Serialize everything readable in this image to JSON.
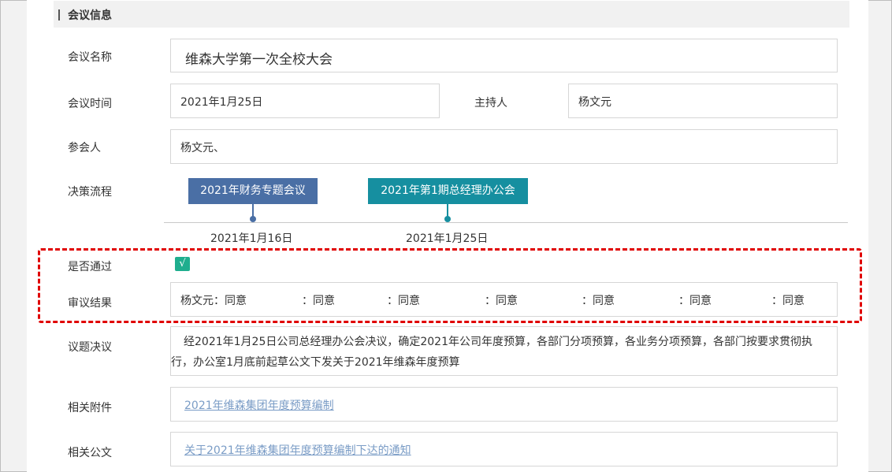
{
  "section": {
    "title": "会议信息"
  },
  "meeting_name": {
    "label": "会议名称",
    "value": "维森大学第一次全校大会"
  },
  "meeting_time": {
    "label": "会议时间",
    "value": "2021年1月25日"
  },
  "host": {
    "label": "主持人",
    "value": "杨文元"
  },
  "attendees": {
    "label": "参会人",
    "value": "杨文元、"
  },
  "process": {
    "label": "决策流程",
    "nodes": [
      {
        "title": "2021年财务专题会议",
        "date": "2021年1月16日",
        "color": "#4a6fa5"
      },
      {
        "title": "2021年第1期总经理办公会",
        "date": "2021年1月25日",
        "color": "#168fa0"
      }
    ]
  },
  "passed": {
    "label": "是否通过",
    "mark": "√",
    "color": "#1fae8e"
  },
  "review": {
    "label": "审议结果",
    "items": [
      "杨文元：同意",
      "：同意",
      "：同意",
      "：同意",
      "：同意",
      "：同意",
      "：同意"
    ]
  },
  "decision": {
    "label": "议题决议",
    "text": "经2021年1月25日公司总经理办公会决议，确定2021年公司年度预算，各部门分项预算，各业务分项预算，各部门按要求贯彻执行，办公室1月底前起草公文下发关于2021年维森年度预算"
  },
  "attachments": {
    "label": "相关附件",
    "link": "2021年维森集团年度预算编制"
  },
  "documents": {
    "label": "相关公文",
    "link": "关于2021年维森集团年度预算编制下达的通知"
  }
}
